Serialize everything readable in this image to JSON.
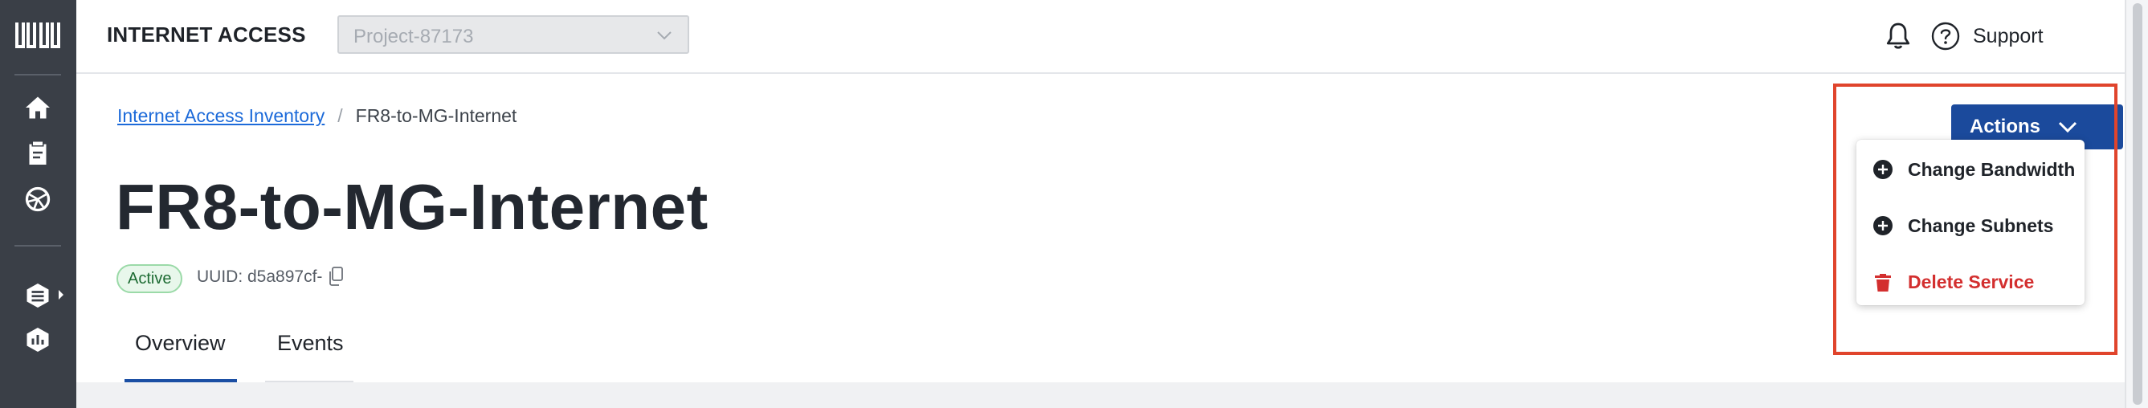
{
  "app": {
    "title": "INTERNET ACCESS"
  },
  "project_select": {
    "value": "Project-87173"
  },
  "header": {
    "support_label": "Support"
  },
  "rail": {
    "icons": [
      "equinix-logo-icon",
      "home-icon",
      "clipboard-icon",
      "globe-network-icon",
      "stack-icon",
      "chart-icon"
    ]
  },
  "breadcrumb": {
    "parent": "Internet Access Inventory",
    "separator": "/",
    "current": "FR8-to-MG-Internet"
  },
  "page": {
    "title": "FR8-to-MG-Internet",
    "status": "Active",
    "uuid": "UUID: d5a897cf-"
  },
  "tabs": [
    {
      "label": "Overview",
      "active": true
    },
    {
      "label": "Events",
      "active": false
    }
  ],
  "actions": {
    "label": "Actions",
    "menu": [
      {
        "label": "Change Bandwidth",
        "icon": "plus-circle-icon"
      },
      {
        "label": "Change Subnets",
        "icon": "plus-circle-icon"
      },
      {
        "label": "Delete Service",
        "icon": "trash-icon",
        "danger": true
      }
    ]
  },
  "colors": {
    "rail": "#3a3f47",
    "primary": "#1b4a9c",
    "link": "#1c6ad9",
    "danger": "#d32f2f",
    "highlight": "#e0442c",
    "active_badge_bg": "#e8f7eb"
  }
}
